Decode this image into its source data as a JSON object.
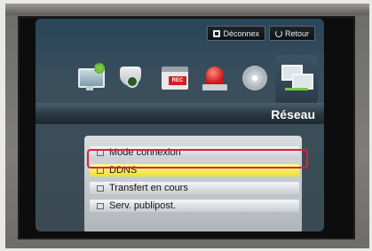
{
  "topbar": {
    "logout_label": "Déconnex",
    "return_label": "Retour"
  },
  "icons": [
    "monitor-settings-icon",
    "camera-dome-icon",
    "rec-calendar-icon",
    "alarm-icon",
    "disk-icon",
    "network-icon"
  ],
  "icon_rec_text": "REC",
  "page_title": "Réseau",
  "menu": {
    "items": [
      {
        "label": "Mode connexion",
        "icon": "network-mode-icon"
      },
      {
        "label": "DDNS",
        "icon": "ddns-icon",
        "selected": true
      },
      {
        "label": "Transfert en cours",
        "icon": "transfer-icon"
      },
      {
        "label": "Serv. publipost.",
        "icon": "mail-icon"
      }
    ]
  },
  "colors": {
    "selection_outline": "#e0203a",
    "selected_item": "#f0dd30"
  }
}
